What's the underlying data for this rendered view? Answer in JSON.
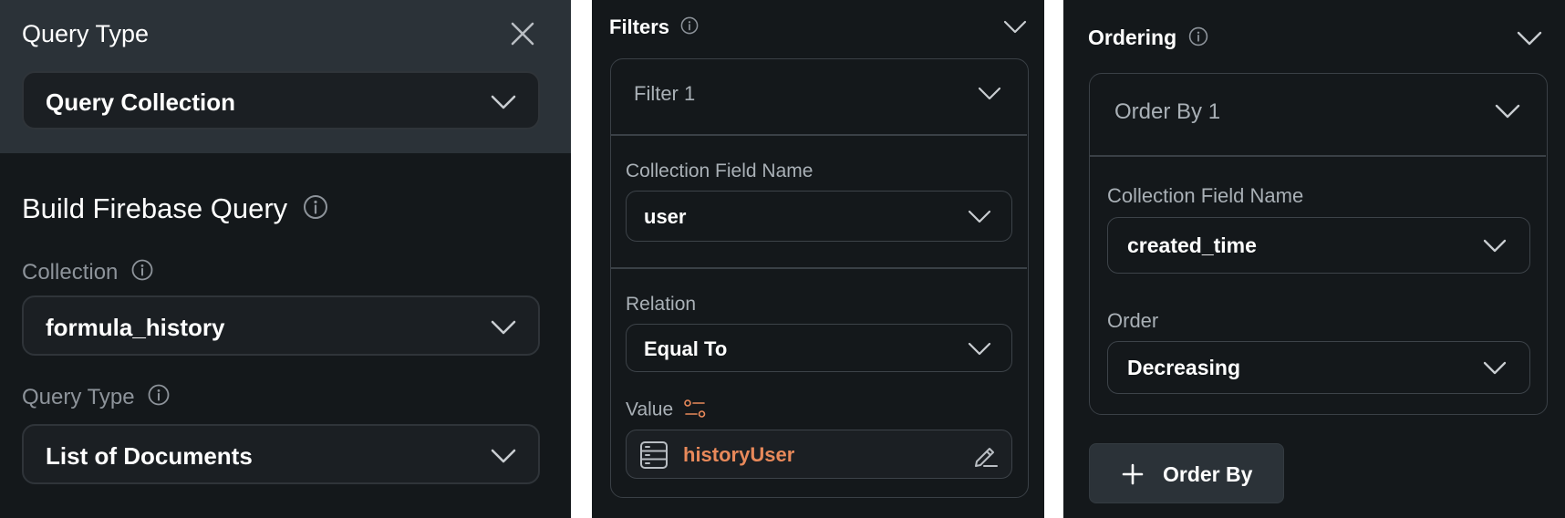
{
  "panel1": {
    "header_title": "Query Type",
    "top_dropdown_value": "Query Collection",
    "section_title": "Build Firebase Query",
    "collection_label": "Collection",
    "collection_value": "formula_history",
    "query_type_label": "Query Type",
    "query_type_value": "List of Documents"
  },
  "panel2": {
    "title": "Filters",
    "filter_title": "Filter 1",
    "field_label": "Collection Field Name",
    "field_value": "user",
    "relation_label": "Relation",
    "relation_value": "Equal To",
    "value_label": "Value",
    "value_text": "historyUser"
  },
  "panel3": {
    "title": "Ordering",
    "order_title": "Order By 1",
    "field_label": "Collection Field Name",
    "field_value": "created_time",
    "order_label": "Order",
    "order_value": "Decreasing",
    "add_button_label": "Order By"
  },
  "colors": {
    "panel_bg": "#14181b",
    "header_bg": "#2b3238",
    "accent_orange": "#e8895a",
    "label_gray": "#8d939a"
  },
  "icons": [
    "close-icon",
    "chevron-down-icon",
    "info-icon",
    "variable-icon",
    "database-icon",
    "edit-icon",
    "plus-icon"
  ]
}
